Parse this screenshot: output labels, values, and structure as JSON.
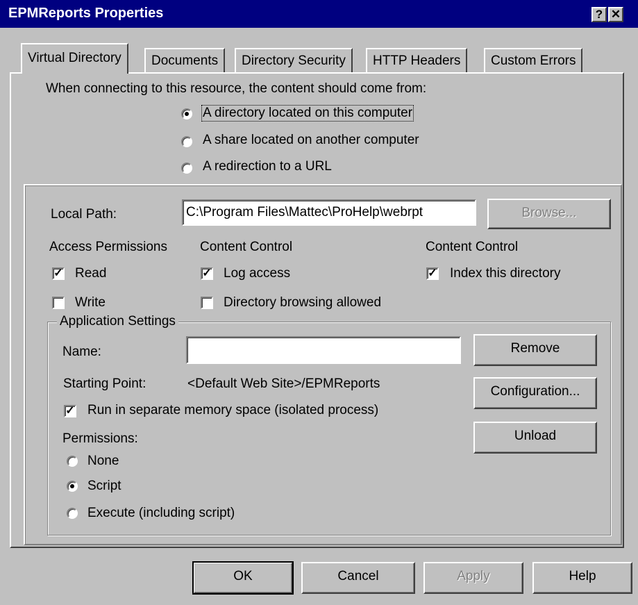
{
  "window": {
    "title": "EPMReports Properties",
    "help_btn": "?",
    "close_btn": "✕"
  },
  "tabs": [
    {
      "label": "Virtual Directory"
    },
    {
      "label": "Documents"
    },
    {
      "label": "Directory Security"
    },
    {
      "label": "HTTP Headers"
    },
    {
      "label": "Custom Errors"
    }
  ],
  "source": {
    "prompt": "When connecting to this resource, the content should come from:",
    "options": [
      {
        "label": "A directory located on this computer",
        "selected": true
      },
      {
        "label": "A share located on another computer",
        "selected": false
      },
      {
        "label": "A redirection to a URL",
        "selected": false
      }
    ]
  },
  "local_path": {
    "label": "Local Path:",
    "value": "C:\\Program Files\\Mattec\\ProHelp\\webrpt",
    "browse": "Browse..."
  },
  "access": {
    "header": "Access Permissions",
    "read": {
      "label": "Read",
      "checked": true
    },
    "write": {
      "label": "Write",
      "checked": false
    }
  },
  "content_control_1": {
    "header": "Content Control",
    "log_access": {
      "label": "Log access",
      "checked": true
    },
    "dir_browsing": {
      "label": "Directory browsing allowed",
      "checked": false
    }
  },
  "content_control_2": {
    "header": "Content Control",
    "index": {
      "label": "Index this directory",
      "checked": true
    }
  },
  "app": {
    "group_label": "Application Settings",
    "name_label": "Name:",
    "name_value": "",
    "starting_point_label": "Starting Point:",
    "starting_point_value": "<Default Web Site>/EPMReports",
    "isolated": {
      "label": "Run in separate memory space (isolated process)",
      "checked": true
    },
    "permissions_label": "Permissions:",
    "permissions": [
      {
        "label": "None",
        "selected": false
      },
      {
        "label": "Script",
        "selected": true
      },
      {
        "label": "Execute (including script)",
        "selected": false
      }
    ],
    "remove": "Remove",
    "configuration": "Configuration...",
    "unload": "Unload"
  },
  "footer": {
    "ok": "OK",
    "cancel": "Cancel",
    "apply": "Apply",
    "help": "Help"
  },
  "colors": {
    "face": "#c0c0c0",
    "titlebar": "#000080",
    "disabled_text": "#808080"
  }
}
